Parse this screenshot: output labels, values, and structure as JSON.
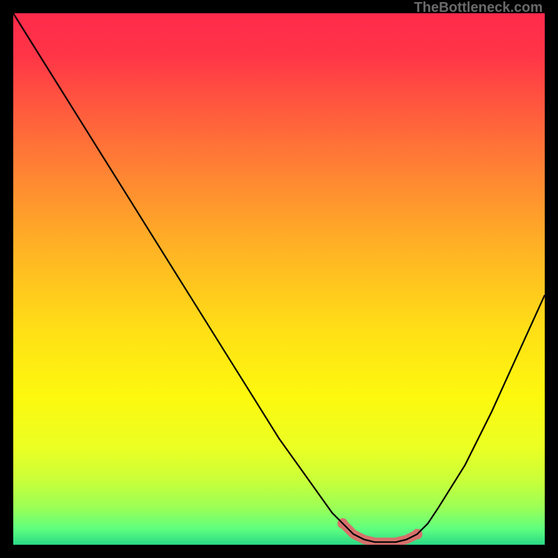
{
  "watermark": "TheBottleneck.com",
  "chart_data": {
    "type": "line",
    "title": "",
    "xlabel": "",
    "ylabel": "",
    "xlim": [
      0,
      100
    ],
    "ylim": [
      0,
      100
    ],
    "series": [
      {
        "name": "curve",
        "x": [
          0,
          5,
          10,
          15,
          20,
          25,
          30,
          35,
          40,
          45,
          50,
          55,
          60,
          62,
          64,
          66,
          68,
          70,
          72,
          74,
          76,
          78,
          80,
          85,
          90,
          95,
          100
        ],
        "y": [
          100,
          92,
          84,
          76,
          68,
          60,
          52,
          44,
          36,
          28,
          20,
          13,
          6,
          4,
          2,
          1,
          0.5,
          0.5,
          0.5,
          1,
          2,
          4,
          7,
          15,
          25,
          36,
          47
        ]
      }
    ],
    "highlight_band": {
      "x_start": 62,
      "x_end": 77,
      "color": "#d6706b"
    },
    "gradient_stops": [
      {
        "offset": 0.0,
        "color": "#ff2a4b"
      },
      {
        "offset": 0.08,
        "color": "#ff3547"
      },
      {
        "offset": 0.18,
        "color": "#ff5a3e"
      },
      {
        "offset": 0.3,
        "color": "#ff8433"
      },
      {
        "offset": 0.45,
        "color": "#ffb524"
      },
      {
        "offset": 0.6,
        "color": "#ffe016"
      },
      {
        "offset": 0.72,
        "color": "#fdf80e"
      },
      {
        "offset": 0.82,
        "color": "#eaff24"
      },
      {
        "offset": 0.88,
        "color": "#c8ff3a"
      },
      {
        "offset": 0.93,
        "color": "#9cff56"
      },
      {
        "offset": 0.97,
        "color": "#5eff7f"
      },
      {
        "offset": 1.0,
        "color": "#2bd985"
      }
    ]
  }
}
